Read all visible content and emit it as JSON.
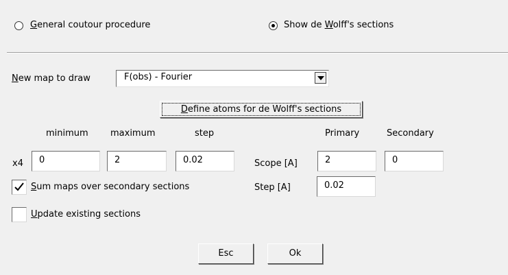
{
  "mode": {
    "general_contour_label": "General coutour procedure",
    "general_contour_selected": false,
    "show_dewolff_label": "Show de Wolff's sections",
    "show_dewolff_selected": true
  },
  "map": {
    "new_map_label": "New map to draw",
    "selected_map": "F(obs) - Fourier",
    "define_atoms_button": "Define atoms for de Wolff's sections"
  },
  "range_headers": {
    "minimum": "minimum",
    "maximum": "maximum",
    "step": "step"
  },
  "x4": {
    "label": "x4",
    "minimum": "0",
    "maximum": "2",
    "step": "0.02"
  },
  "scope_headers": {
    "primary": "Primary",
    "secondary": "Secondary"
  },
  "scope": {
    "label": "Scope [A]",
    "primary": "2",
    "secondary": "0"
  },
  "step_row": {
    "label": "Step [A]",
    "value": "0.02"
  },
  "options": {
    "sum_maps_label": "Sum maps over secondary sections",
    "sum_maps_checked": true,
    "update_existing_label": "Update existing sections",
    "update_existing_checked": false
  },
  "buttons": {
    "esc": "Esc",
    "ok": "Ok"
  }
}
